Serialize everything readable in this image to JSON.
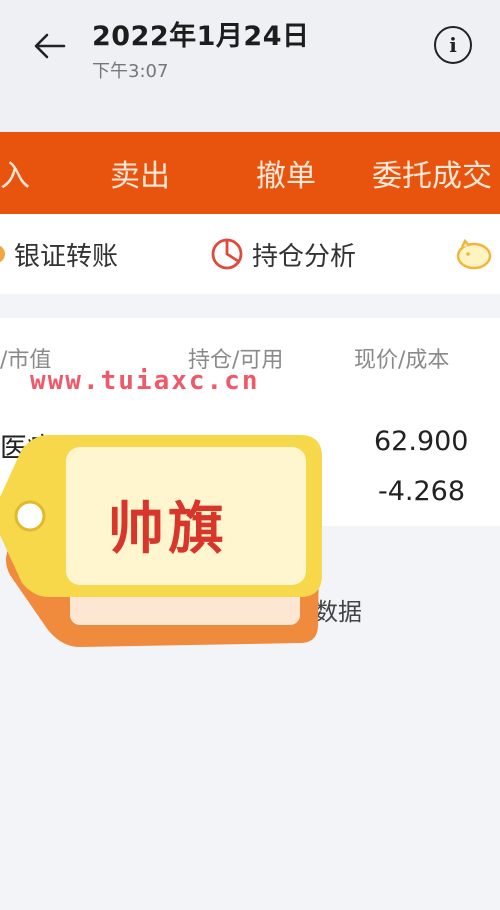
{
  "header": {
    "title": "2022年1月24日",
    "subtitle": "下午3:07"
  },
  "action_bar": {
    "items": [
      "入",
      "卖出",
      "撤单",
      "委托成交"
    ]
  },
  "tools": {
    "items": [
      {
        "label": "银证转账",
        "icon": "bank-transfer-icon"
      },
      {
        "label": "持仓分析",
        "icon": "pie-chart-icon"
      },
      {
        "label": "",
        "icon": "piggy-bank-icon"
      }
    ]
  },
  "table": {
    "headers": [
      "/市值",
      "持仓/可用",
      "现价/成本"
    ],
    "rows": [
      {
        "name": "医疗",
        "name_sub": "",
        "position": "",
        "price": "62.900",
        "cost": "-4.268"
      }
    ]
  },
  "watermark": "www.tuiaxc.cn",
  "footer": {
    "text": "仓数据"
  },
  "sticker": {
    "text": "帅旗"
  },
  "colors": {
    "accent": "#e8540e",
    "sticker_yellow": "#f6d84a",
    "sticker_orange": "#f08a3c",
    "watermark": "#ef5a6a"
  }
}
